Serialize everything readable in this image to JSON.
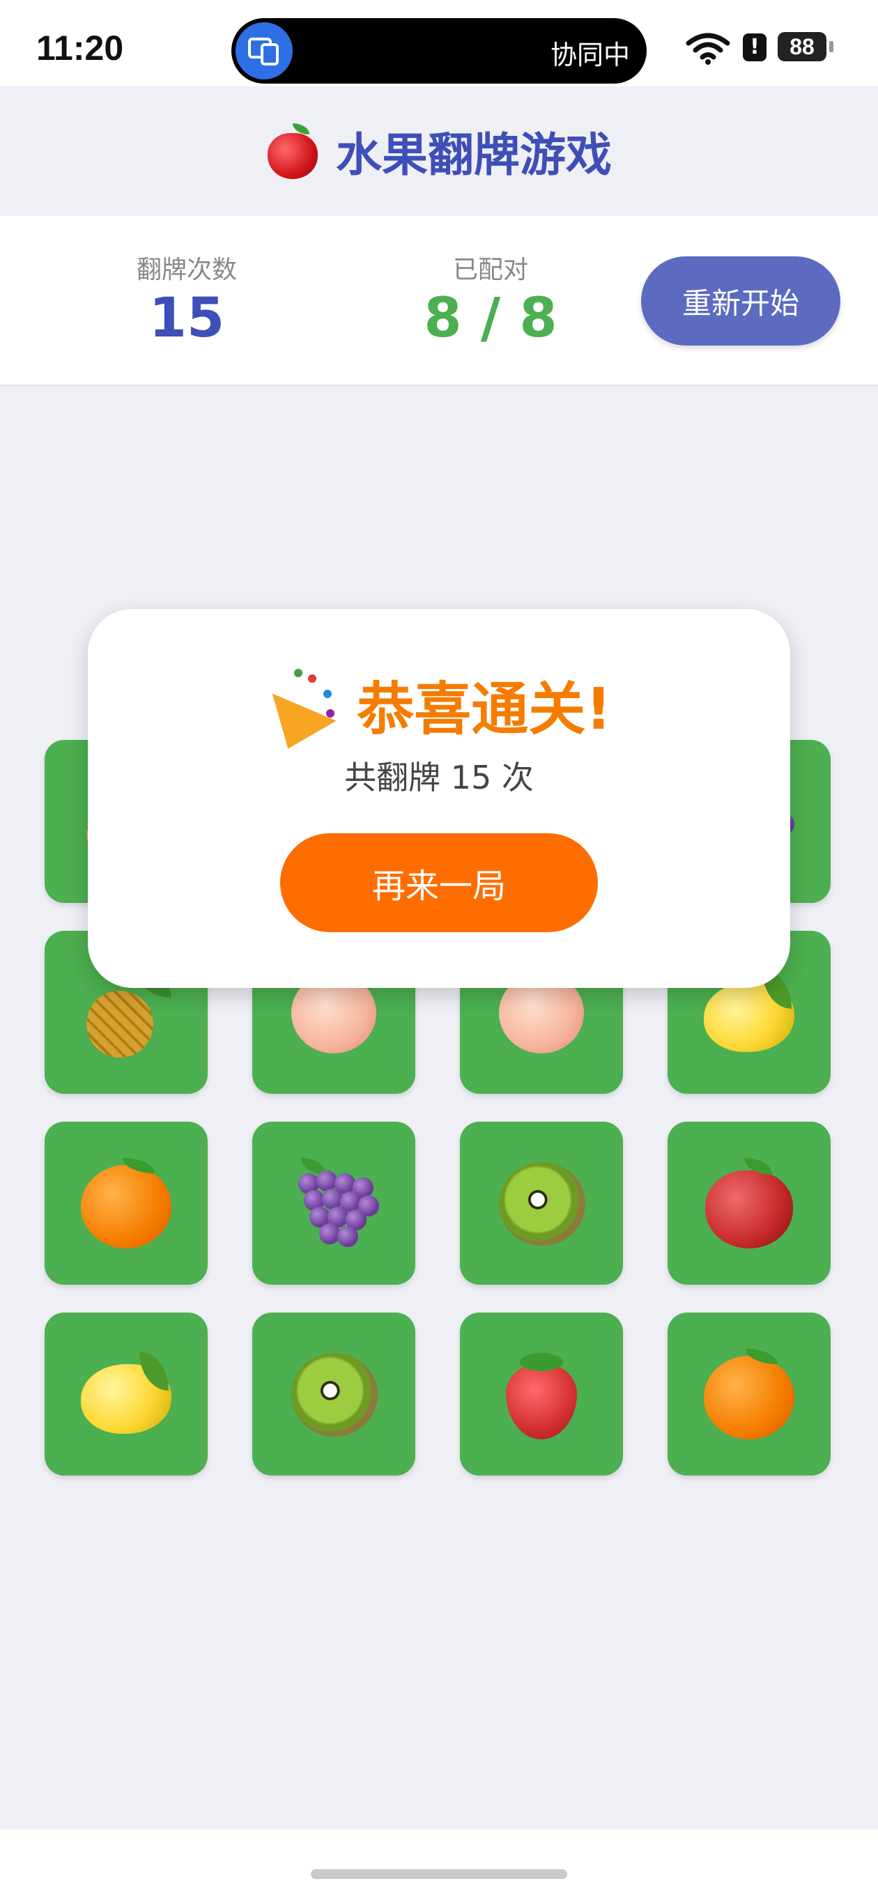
{
  "status_bar": {
    "time": "11:20",
    "island_text": "协同中",
    "battery": "88",
    "alert": "!"
  },
  "header": {
    "title": "水果翻牌游戏"
  },
  "stats": {
    "flips_label": "翻牌次数",
    "flips_value": "15",
    "pairs_label": "已配对",
    "pairs_value": "8 / 8",
    "restart_label": "重新开始"
  },
  "board": {
    "cards": [
      {
        "fruit": "pineapple-icon"
      },
      {
        "fruit": "hidden"
      },
      {
        "fruit": "hidden"
      },
      {
        "fruit": "grapes-icon"
      },
      {
        "fruit": "pineapple-icon"
      },
      {
        "fruit": "peach-icon"
      },
      {
        "fruit": "peach-icon"
      },
      {
        "fruit": "lemon-icon"
      },
      {
        "fruit": "orange-icon"
      },
      {
        "fruit": "grapes-icon"
      },
      {
        "fruit": "kiwi-icon"
      },
      {
        "fruit": "apple-icon"
      },
      {
        "fruit": "lemon-icon"
      },
      {
        "fruit": "kiwi-icon"
      },
      {
        "fruit": "strawberry-icon"
      },
      {
        "fruit": "orange-icon"
      }
    ]
  },
  "dialog": {
    "title": "恭喜通关!",
    "summary": "共翻牌 15 次",
    "again_label": "再来一局"
  },
  "colors": {
    "accent": "#5c6bc0",
    "title": "#3f4fb8",
    "card": "#4caf50",
    "success": "#4caf50",
    "dialog_title": "#f57c00",
    "dialog_button": "#ff6d00"
  }
}
